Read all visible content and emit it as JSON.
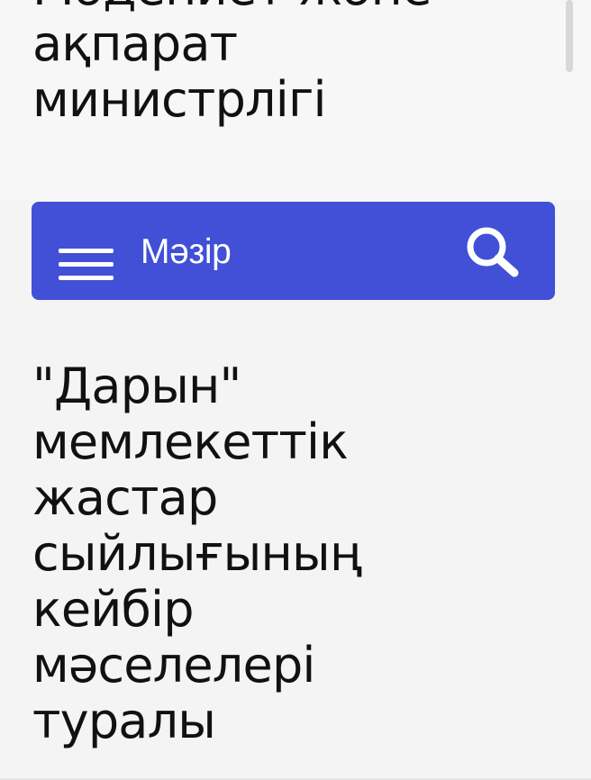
{
  "header": {
    "ministry_title": "Мәдениет және\nақпарат\nминистрлігі"
  },
  "navigation": {
    "menu_label": "Мәзір",
    "menu_icon": "hamburger-menu-icon",
    "search_icon": "search-icon"
  },
  "main": {
    "title": "\"Дарын\"\nмемлекеттік\nжастар\nсыйлығының\nкейбір\nмәселелері\nтуралы"
  },
  "colors": {
    "accent": "#4150d7",
    "background": "#f4f4f4",
    "text": "#111111",
    "nav_text": "#ffffff"
  }
}
